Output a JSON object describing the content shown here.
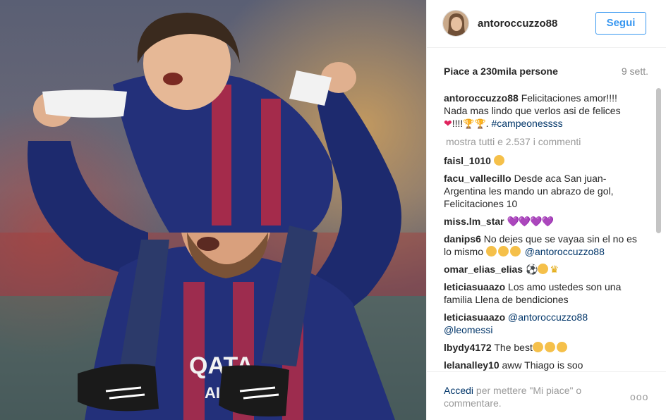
{
  "post": {
    "username": "antoroccuzzo88",
    "follow_label": "Segui",
    "likes": "Piace a 230mila persone",
    "time": "9 sett."
  },
  "caption": {
    "user": "antoroccuzzo88",
    "text": "Felicitaciones amor!!!! Nada mas lindo que verlos asi de felices",
    "text_after": "!!!!",
    "hashtag": "#campeonessss"
  },
  "show_all": "mostra tutti e 2.537 i commenti",
  "comments": [
    {
      "user": "faisl_1010",
      "text": ""
    },
    {
      "user": "facu_vallecillo",
      "text": "Desde aca San juan-Argentina les mando un abrazo de gol, Felicitaciones 10"
    },
    {
      "user": "miss.lm_star",
      "text": ""
    },
    {
      "user": "danips6",
      "text": "No dejes que se vayaa sin el no es lo mismo",
      "mention": "@antoroccuzzo88"
    },
    {
      "user": "omar_elias_elias",
      "text": ""
    },
    {
      "user": "leticiasuaazo",
      "text": "Los amo ustedes son una familia Llena de bendiciones"
    },
    {
      "user": "leticiasuaazo",
      "mention": "@antoroccuzzo88",
      "mention2": "@leomessi"
    },
    {
      "user": "lbydy4172",
      "text": "The best"
    },
    {
      "user": "lelanalley10",
      "text": "aww Thiago is soo"
    }
  ],
  "footer": {
    "login": "Accedi",
    "text": "per mettere \"Mi piace\" o commentare.",
    "more": "ooo"
  },
  "icons": {
    "photo": "post-photo",
    "avatar": "user-avatar",
    "more": "more-options-icon"
  },
  "colors": {
    "link": "#003569",
    "follow": "#3897f0",
    "muted": "#999999"
  }
}
